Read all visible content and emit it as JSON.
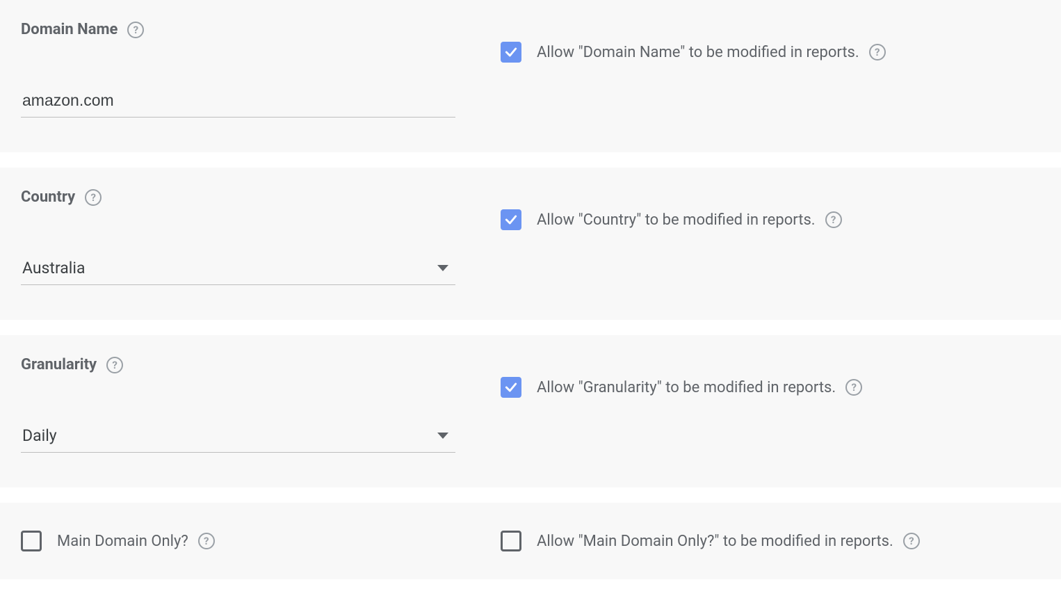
{
  "sections": {
    "domain_name": {
      "label": "Domain Name",
      "input_value": "amazon.com",
      "allow_label": "Allow \"Domain Name\" to be modified in reports.",
      "allow_checked": true
    },
    "country": {
      "label": "Country",
      "select_value": "Australia",
      "allow_label": "Allow \"Country\" to be modified in reports.",
      "allow_checked": true
    },
    "granularity": {
      "label": "Granularity",
      "select_value": "Daily",
      "allow_label": "Allow \"Granularity\" to be modified in reports.",
      "allow_checked": true
    },
    "main_domain_only": {
      "label": "Main Domain Only?",
      "checked": false,
      "allow_label": "Allow \"Main Domain Only?\" to be modified in reports.",
      "allow_checked": false
    }
  }
}
